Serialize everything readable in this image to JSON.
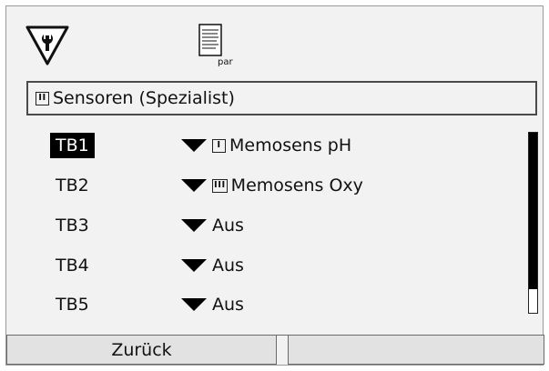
{
  "header": {
    "service_icon": "wrench-triangle-icon",
    "param_icon": "parameter-document-icon",
    "param_icon_label": "par"
  },
  "path": {
    "level": "II",
    "title": "Sensoren (Spezialist)"
  },
  "rows": [
    {
      "label": "TB1",
      "value": "Memosens pH",
      "channel": "I",
      "selected": true
    },
    {
      "label": "TB2",
      "value": "Memosens Oxy",
      "channel": "III",
      "selected": false
    },
    {
      "label": "TB3",
      "value": "Aus",
      "channel": "",
      "selected": false
    },
    {
      "label": "TB4",
      "value": "Aus",
      "channel": "",
      "selected": false
    },
    {
      "label": "TB5",
      "value": "Aus",
      "channel": "",
      "selected": false
    }
  ],
  "scroll": {
    "visible_fraction": 0.87
  },
  "softkeys": {
    "left_label": "Zurück",
    "right_label": ""
  },
  "colors": {
    "selection_bg": "#000000",
    "selection_fg": "#ffffff",
    "panel_bg": "#f2f2f2"
  }
}
